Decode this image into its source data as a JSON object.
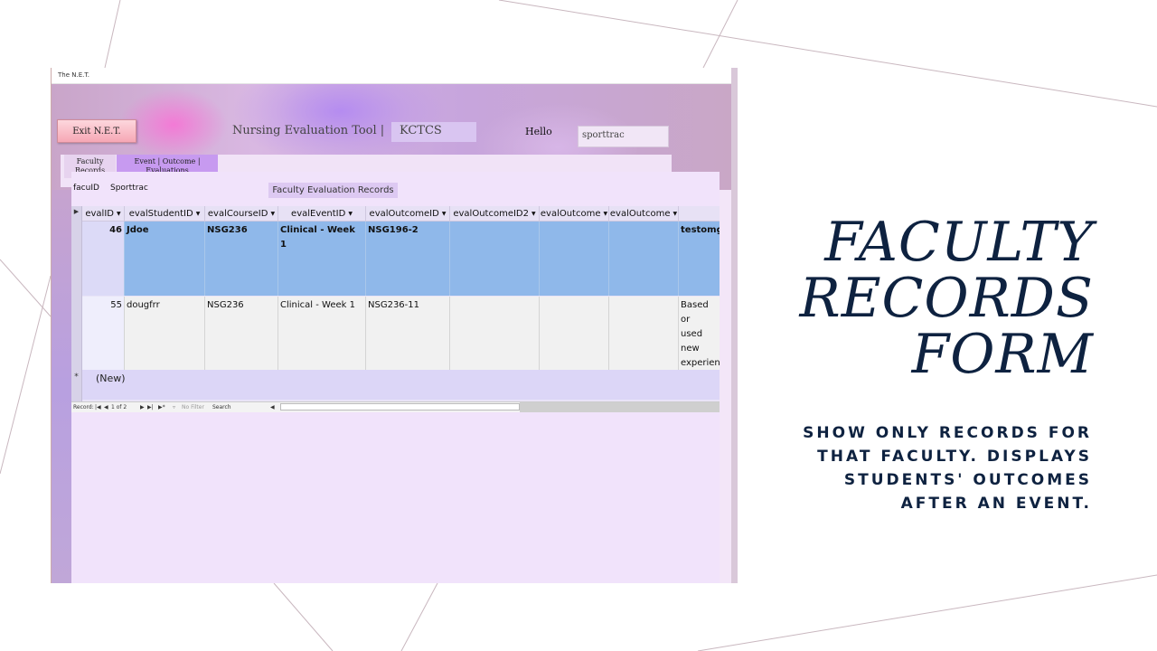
{
  "window": {
    "title": "The N.E.T."
  },
  "header": {
    "exit_label": "Exit N.E.T.",
    "app_title": "Nursing Evaluation Tool   |",
    "org": "KCTCS",
    "hello_label": "Hello",
    "username": "sporttrac"
  },
  "tabs": [
    {
      "label": "Faculty Records"
    },
    {
      "label": "Event | Outcome | Evaluations"
    }
  ],
  "form": {
    "facu_label": "facuID",
    "facu_value": "Sporttrac",
    "records_title": "Faculty Evaluation Records"
  },
  "table": {
    "columns": [
      "evalID",
      "evalStudentID",
      "evalCourseID",
      "evalEventID",
      "evalOutcomeID",
      "evalOutcomeID2",
      "evalOutcome",
      "evalOutcome",
      ""
    ],
    "rows": [
      {
        "evalID": "46",
        "evalStudentID": "Jdoe",
        "evalCourseID": "NSG236",
        "evalEventID": "Clinical - Week 1",
        "evalOutcomeID": "NSG196-2",
        "evalOutcomeID2": "",
        "evalOutcome": "",
        "evalOutcome_2": "",
        "notes": "testomg"
      },
      {
        "evalID": "55",
        "evalStudentID": "dougfrr",
        "evalCourseID": "NSG236",
        "evalEventID": "Clinical - Week 1",
        "evalOutcomeID": "NSG236-11",
        "evalOutcomeID2": "",
        "evalOutcome": "",
        "evalOutcome_2": "",
        "notes": "Based or\nused new\nexperien\n\nXI.  Use"
      }
    ],
    "new_row_label": "(New)"
  },
  "nav": {
    "record_label": "Record:",
    "position": "1 of 2",
    "filter_label": "No Filter",
    "search_label": "Search"
  },
  "slide": {
    "title": "FACULTY RECORDS FORM",
    "subtitle": "SHOW ONLY RECORDS FOR THAT FACULTY.  DISPLAYS STUDENTS' OUTCOMES AFTER AN EVENT."
  }
}
